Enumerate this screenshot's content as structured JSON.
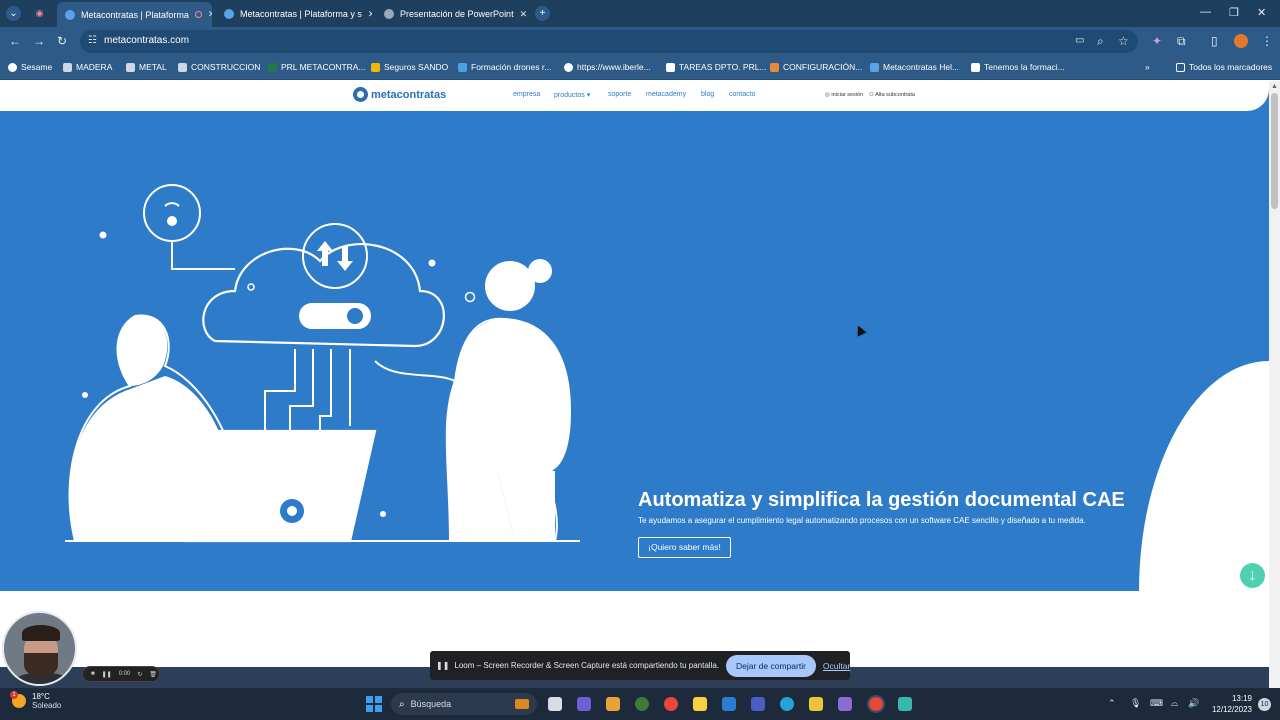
{
  "browser": {
    "tabs": [
      {
        "title": "Metacontratas | Plataforma"
      },
      {
        "title": "Metacontratas | Plataforma y s"
      },
      {
        "title": "Presentación de PowerPoint"
      }
    ],
    "url": "metacontratas.com",
    "bookmarks": [
      {
        "label": "Sesame",
        "icon": "sesame-icon",
        "color": "#ffffff"
      },
      {
        "label": "MADERA",
        "icon": "bars-icon",
        "color": "#ffffff"
      },
      {
        "label": "METAL",
        "icon": "bars-icon",
        "color": "#ffffff"
      },
      {
        "label": "CONSTRUCCION",
        "icon": "bars-icon",
        "color": "#ffffff"
      },
      {
        "label": "PRL METACONTRA...",
        "icon": "excel-icon",
        "color": "#1e7b45"
      },
      {
        "label": "Seguros SANDO",
        "icon": "sando-icon",
        "color": "#f2b705"
      },
      {
        "label": "Formación drones r...",
        "icon": "drone-icon",
        "color": "#4aa3df"
      },
      {
        "label": "https://www.iberle...",
        "icon": "google-icon",
        "color": "#ffffff"
      },
      {
        "label": "TAREAS DPTO. PRL...",
        "icon": "sheet-icon",
        "color": "#ffffff"
      },
      {
        "label": "CONFIGURACIÓN...",
        "icon": "config-icon",
        "color": "#e8883a"
      },
      {
        "label": "Metacontratas Hel...",
        "icon": "help-icon",
        "color": "#5ba2e8"
      },
      {
        "label": "Tenemos la formaci...",
        "icon": "doc-icon",
        "color": "#ffffff"
      }
    ],
    "all_bookmarks": "Todos los marcadores",
    "ext_badge": "1"
  },
  "site": {
    "brand": "metacontratas",
    "nav": [
      "empresa",
      "productos",
      "soporte",
      "metacademy",
      "blog",
      "contacto"
    ],
    "login": "iniciar sesión",
    "signup": "Alta subcontrata",
    "hero": {
      "title": "Automatiza y simplifica la gestión documental CAE",
      "subtitle": "Te ayudamos a asegurar el cumplimiento legal automatizando procesos con un software CAE sencillo y diseñado a tu medida.",
      "cta": "¡Quiero saber más!"
    },
    "colors": {
      "hero": "#2d7bc9",
      "accent": "#4fd1b0",
      "brand": "#2a6fb5"
    }
  },
  "loom": {
    "message": "Loom – Screen Recorder & Screen Capture está compartiendo tu pantalla.",
    "stop": "Dejar de compartir",
    "hide": "Ocultar",
    "timer": "0:00"
  },
  "taskbar": {
    "temp": "18°C",
    "weather": "Soleado",
    "weather_badge": "1",
    "search": "Búsqueda",
    "time": "13:19",
    "date": "12/12/2023",
    "notif": "10"
  }
}
